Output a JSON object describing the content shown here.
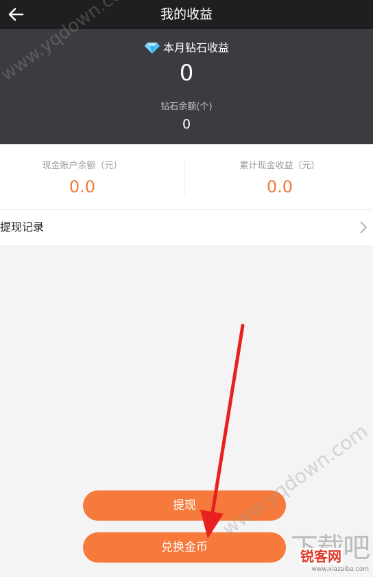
{
  "header": {
    "title": "我的收益"
  },
  "diamond": {
    "label": "本月钻石收益",
    "value": "0",
    "balance_label": "钻石余额(个)",
    "balance_value": "0"
  },
  "cash": {
    "account_label": "现金账户余额（元）",
    "account_value": "0.0",
    "total_label": "累计现金收益（元）",
    "total_value": "0.0"
  },
  "records": {
    "label": "提现记录"
  },
  "buttons": {
    "withdraw": "提现",
    "exchange": "兑换金币"
  },
  "watermarks": {
    "top": "www.yqdown.com",
    "bottom": "www.yqdown.com",
    "logo_big": "下载吧",
    "logo_small": "锐客网",
    "logo_url": "www.xiazaiba.com"
  },
  "colors": {
    "accent": "#f57a3c",
    "value_orange": "#f07a3a",
    "header_bg": "#1f1f21",
    "hero_bg": "#3c3c40",
    "annotation_arrow": "#e8201e"
  },
  "icons": {
    "back": "back-arrow-icon",
    "diamond": "diamond-icon",
    "chevron": "chevron-right-icon"
  }
}
